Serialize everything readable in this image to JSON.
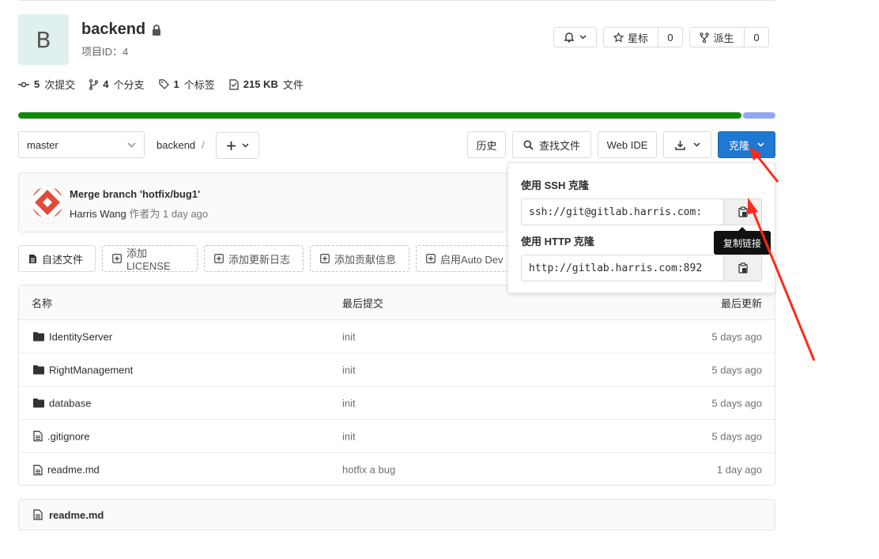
{
  "project": {
    "avatar_letter": "B",
    "name": "backend",
    "id_label": "项目ID：4"
  },
  "actions": {
    "star_label": "星标",
    "star_count": "0",
    "fork_label": "派生",
    "fork_count": "0"
  },
  "stats": [
    {
      "count": "5",
      "label": "次提交"
    },
    {
      "count": "4",
      "label": "个分支"
    },
    {
      "count": "1",
      "label": "个标签"
    },
    {
      "count": "215 KB",
      "label": "文件"
    }
  ],
  "language_bar": {
    "colors": [
      "#10890c",
      "#8fa8f0"
    ],
    "percent": [
      95.7,
      4.3
    ]
  },
  "toolbar": {
    "branch": "master",
    "path_root": "backend",
    "path_sep": "/",
    "history": "历史",
    "find_file": "查找文件",
    "web_ide": "Web IDE",
    "clone": "克隆"
  },
  "commit": {
    "title": "Merge branch 'hotfix/bug1'",
    "author": "Harris Wang",
    "authored_label": "作者为",
    "time": "1 day ago"
  },
  "quick_buttons": {
    "readme": "自述文件",
    "add_license": "添加LICENSE",
    "add_changelog": "添加更新日志",
    "add_contributing": "添加贡献信息",
    "enable_autodevops": "启用Auto Dev"
  },
  "table": {
    "headers": {
      "name": "名称",
      "last_commit": "最后提交",
      "last_update": "最后更新"
    },
    "rows": [
      {
        "name": "IdentityServer",
        "type": "folder",
        "commit": "init",
        "updated": "5 days ago"
      },
      {
        "name": "RightManagement",
        "type": "folder",
        "commit": "init",
        "updated": "5 days ago"
      },
      {
        "name": "database",
        "type": "folder",
        "commit": "init",
        "updated": "5 days ago"
      },
      {
        "name": ".gitignore",
        "type": "file",
        "commit": "init",
        "updated": "5 days ago"
      },
      {
        "name": "readme.md",
        "type": "file",
        "commit": "hotfix a bug",
        "updated": "1 day ago"
      }
    ]
  },
  "readme_header": "readme.md",
  "clone_dropdown": {
    "ssh_label": "使用 SSH 克隆",
    "ssh_url": "ssh://git@gitlab.harris.com:",
    "http_label": "使用 HTTP 克隆",
    "http_url": "http://gitlab.harris.com:892",
    "copy_tooltip": "复制链接"
  },
  "colors": {
    "primary": "#1f78d1",
    "annotation_arrow": "#ff2a1a"
  }
}
